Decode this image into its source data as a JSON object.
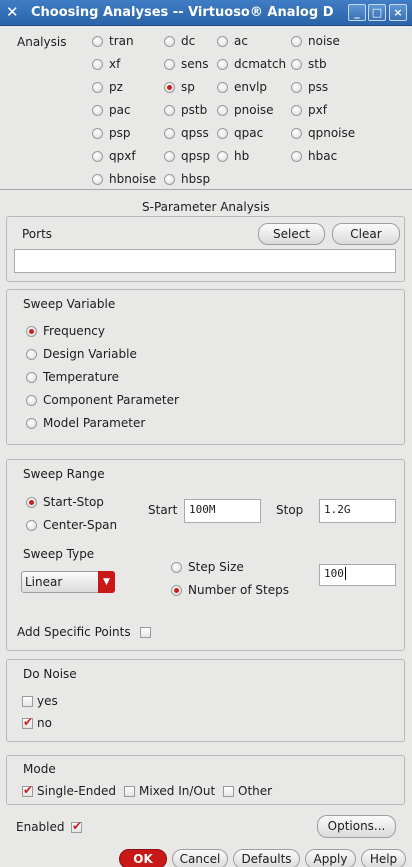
{
  "window": {
    "title": "Choosing Analyses -- Virtuoso® Analog D",
    "minimize": "_",
    "maximize": "□",
    "close": "×"
  },
  "analysis": {
    "label": "Analysis",
    "selected": "sp",
    "options": [
      "tran",
      "dc",
      "ac",
      "noise",
      "xf",
      "sens",
      "dcmatch",
      "stb",
      "pz",
      "sp",
      "envlp",
      "pss",
      "pac",
      "pstb",
      "pnoise",
      "pxf",
      "psp",
      "qpss",
      "qpac",
      "qpnoise",
      "qpxf",
      "qpsp",
      "hb",
      "hbac",
      "hbnoise",
      "hbsp"
    ]
  },
  "sp": {
    "section_title": "S-Parameter Analysis",
    "ports": {
      "label": "Ports",
      "value": "",
      "select_label": "Select",
      "clear_label": "Clear"
    },
    "sweep_variable": {
      "label": "Sweep Variable",
      "selected": "Frequency",
      "options": [
        "Frequency",
        "Design Variable",
        "Temperature",
        "Component Parameter",
        "Model Parameter"
      ]
    },
    "sweep_range": {
      "label": "Sweep Range",
      "selected": "Start-Stop",
      "options": [
        "Start-Stop",
        "Center-Span"
      ],
      "start_label": "Start",
      "start_value": "100M",
      "stop_label": "Stop",
      "stop_value": "1.2G",
      "sweep_type_label": "Sweep Type",
      "sweep_type_value": "Linear",
      "step_options": [
        "Step Size",
        "Number of Steps"
      ],
      "step_selected": "Number of Steps",
      "steps_value": "100",
      "add_points_label": "Add Specific Points",
      "add_points_checked": false
    },
    "do_noise": {
      "label": "Do Noise",
      "options": [
        "yes",
        "no"
      ],
      "checked": "no"
    },
    "mode": {
      "label": "Mode",
      "options": [
        "Single-Ended",
        "Mixed In/Out",
        "Other"
      ],
      "checked": "Single-Ended"
    },
    "enabled_label": "Enabled",
    "enabled": true,
    "options_button": "Options..."
  },
  "footer": {
    "ok": "OK",
    "cancel": "Cancel",
    "defaults": "Defaults",
    "apply": "Apply",
    "help": "Help"
  },
  "colors": {
    "accent_red": "#cf1c1c",
    "titlebar_blue": "#2f6db5",
    "ok_button": "#c81818"
  }
}
